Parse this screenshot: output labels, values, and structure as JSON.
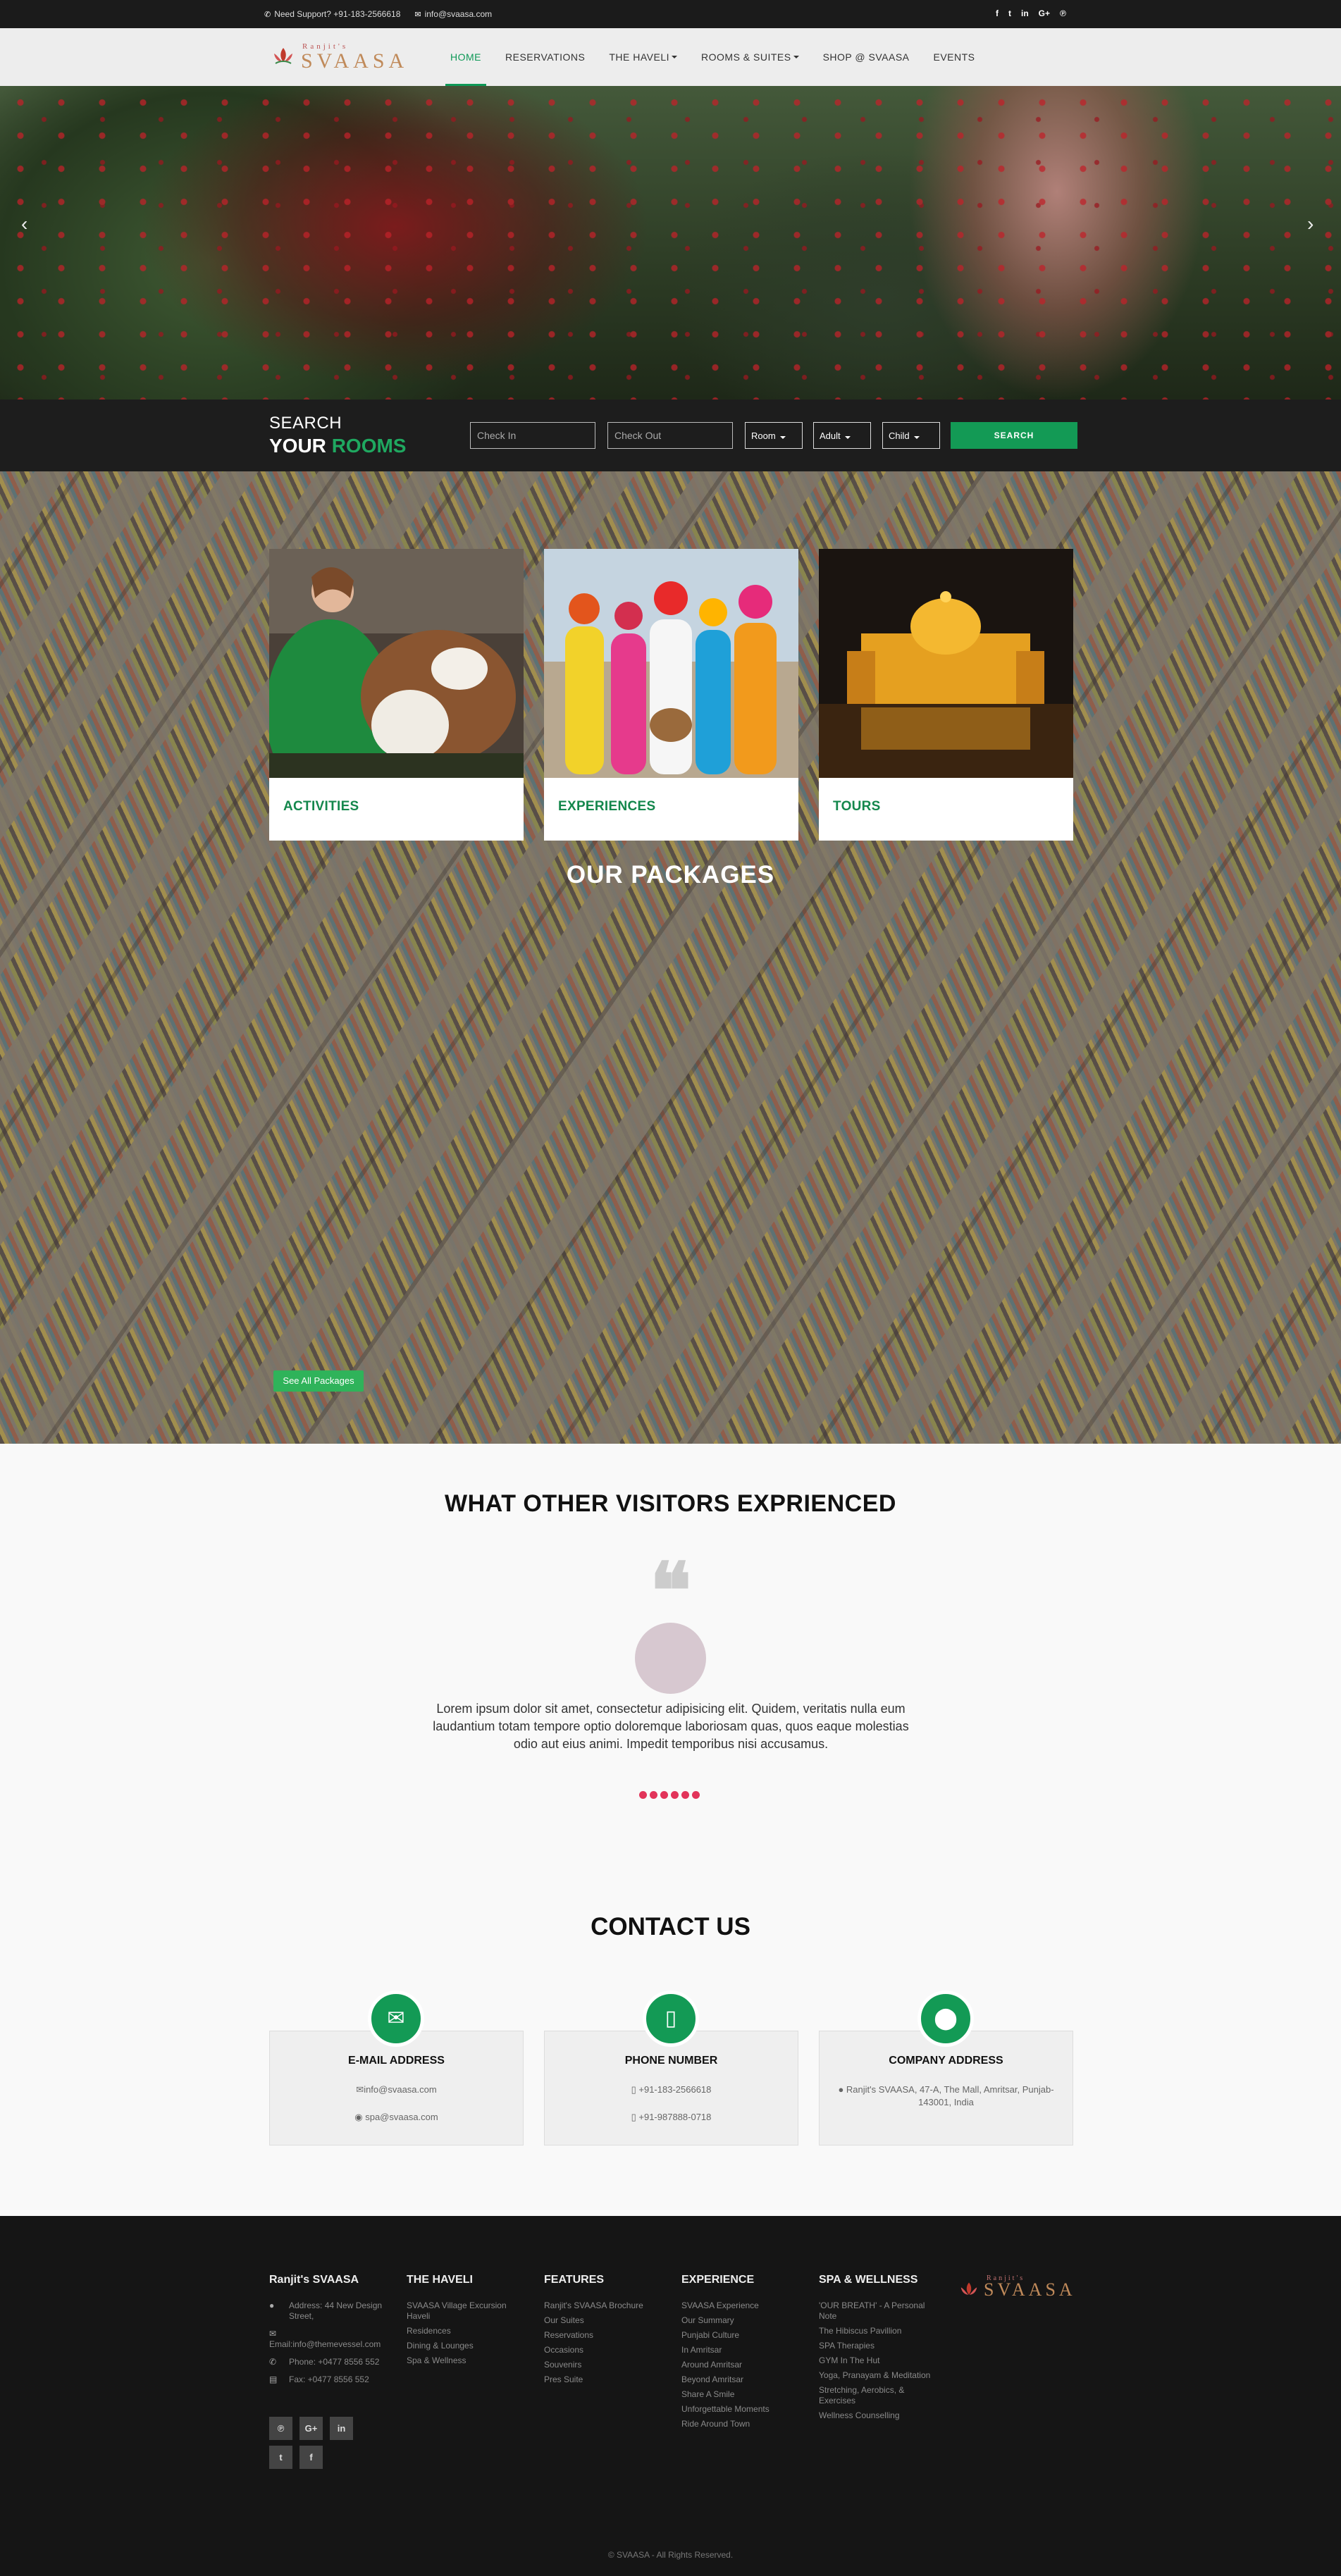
{
  "topbar": {
    "support": "Need Support? +91-183-2566618",
    "email": "info@svaasa.com",
    "social_icons": [
      "facebook-icon",
      "twitter-icon",
      "linkedin-icon",
      "google-plus-icon",
      "pinterest-icon"
    ]
  },
  "logo": {
    "small": "Ranjit's",
    "big": "SVAASA"
  },
  "nav": {
    "items": [
      {
        "label": "HOME",
        "active": true,
        "dropdown": false
      },
      {
        "label": "RESERVATIONS",
        "active": false,
        "dropdown": false
      },
      {
        "label": "THE HAVELI",
        "active": false,
        "dropdown": true
      },
      {
        "label": "ROOMS & SUITES",
        "active": false,
        "dropdown": true
      },
      {
        "label": "SHOP @ SVAASA",
        "active": false,
        "dropdown": false
      },
      {
        "label": "EVENTS",
        "active": false,
        "dropdown": false
      }
    ]
  },
  "hero": {
    "prev": "‹",
    "next": "›"
  },
  "search": {
    "line1": "SEARCH",
    "line2a": "YOUR",
    "line2b": "ROOMS",
    "checkin_placeholder": "Check In",
    "checkout_placeholder": "Check Out",
    "room": "Room",
    "adult": "Adult",
    "child": "Child",
    "button": "SEARCH"
  },
  "cards": [
    {
      "label": "ACTIVITIES"
    },
    {
      "label": "EXPERIENCES"
    },
    {
      "label": "TOURS"
    }
  ],
  "packages": {
    "title": "OUR PACKAGES",
    "see_all": "See All Packages"
  },
  "testimonials": {
    "title": "WHAT OTHER VISITORS EXPRIENCED",
    "quote_mark": "❝",
    "text": "Lorem ipsum dolor sit amet, consectetur adipisicing elit. Quidem, veritatis nulla eum laudantium totam tempore optio doloremque laboriosam quas, quos eaque molestias odio aut eius animi. Impedit temporibus nisi accusamus."
  },
  "contact": {
    "title": "CONTACT US",
    "email_h": "E-MAIL ADDRESS",
    "email_1": "info@svaasa.com",
    "email_2": "spa@svaasa.com",
    "phone_h": "PHONE NUMBER",
    "phone_1": "+91-183-2566618",
    "phone_2": "+91-987888-0718",
    "address_h": "COMPANY ADDRESS",
    "address": "Ranjit's SVAASA, 47-A, The Mall, Amritsar, Punjab-143001, India"
  },
  "footer": {
    "col1": {
      "title": "Ranjit's SVAASA",
      "address": "Address: 44 New Design Street,",
      "email": "Email:info@themevessel.com",
      "phone": "Phone: +0477 8556 552",
      "fax": "Fax: +0477 8556 552"
    },
    "haveli": {
      "title": "THE HAVELI",
      "links": [
        "SVAASA Village Excursion Haveli",
        "Residences",
        "Dining & Lounges",
        "Spa & Wellness"
      ]
    },
    "features": {
      "title": "FEATURES",
      "links": [
        "Ranjit's SVAASA Brochure",
        "Our Suites",
        "Reservations",
        "Occasions",
        "Souvenirs",
        "Pres Suite"
      ]
    },
    "experience": {
      "title": "EXPERIENCE",
      "links": [
        "SVAASA Experience",
        "Our Summary",
        "Punjabi Culture",
        "In Amritsar",
        "Around Amritsar",
        "Beyond Amritsar",
        "Share A Smile",
        "Unforgettable Moments",
        "Ride Around Town"
      ]
    },
    "spa": {
      "title": "SPA & WELLNESS",
      "links": [
        "'OUR BREATH' - A Personal Note",
        "The Hibiscus Pavillion",
        "SPA Therapies",
        "GYM In The Hut",
        "Yoga, Pranayam & Meditation",
        "Stretching, Aerobics, & Exercises",
        "Wellness Counselling"
      ]
    },
    "social": [
      "pinterest-icon",
      "google-plus-icon",
      "linkedin-icon",
      "twitter-icon",
      "facebook-icon"
    ],
    "copyright": "© SVAASA - All Rights Reserved."
  }
}
